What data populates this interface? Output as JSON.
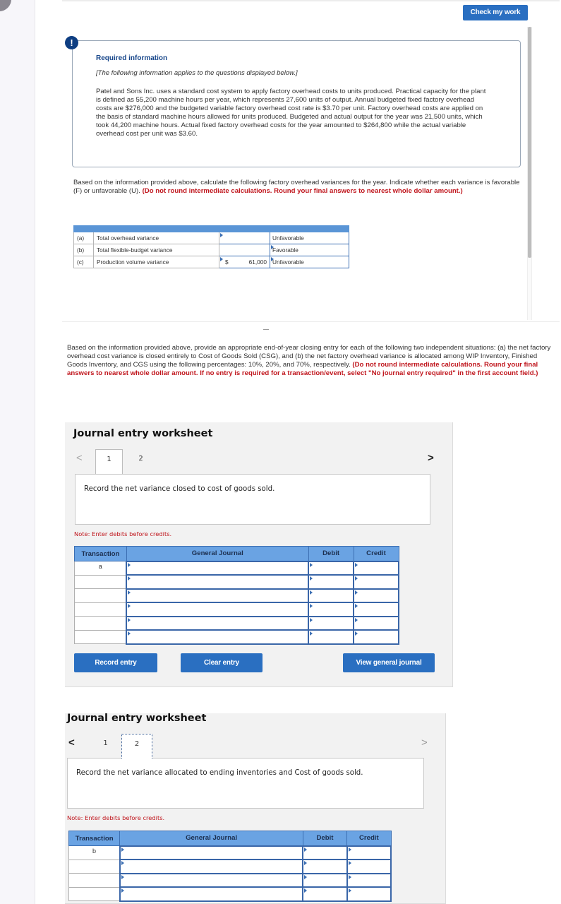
{
  "header": {
    "check_my_work_label": "Check my work"
  },
  "info": {
    "badge": "!",
    "title": "Required information",
    "subtitle": "[The following information applies to the questions displayed below.]",
    "body": "Patel and Sons Inc. uses a standard cost system to apply factory overhead costs to units produced. Practical capacity for the plant is defined as 55,200 machine hours per year, which represents 27,600 units of output. Annual budgeted fixed factory overhead costs are $276,000 and the budgeted variable factory overhead cost rate is $3.70 per unit. Factory overhead costs are applied on the basis of standard machine hours allowed for units produced. Budgeted and actual output for the year was 21,500 units, which took 44,200 machine hours. Actual fixed factory overhead costs for the year amounted to $264,800 while the actual variable overhead cost per unit was $3.60."
  },
  "question1": {
    "text": "Based on the information provided above, calculate the following factory overhead variances for the year. Indicate whether each variance is favorable (F) or unfavorable (U).",
    "instruction": "(Do not round intermediate calculations. Round your final answers to nearest whole dollar amount.)"
  },
  "variances": [
    {
      "letter": "(a)",
      "label": "Total overhead variance",
      "currency": "",
      "amount": "",
      "type": "Unfavorable"
    },
    {
      "letter": "(b)",
      "label": "Total flexible-budget variance",
      "currency": "",
      "amount": "",
      "type": "Favorable"
    },
    {
      "letter": "(c)",
      "label": "Production volume variance",
      "currency": "$",
      "amount": "61,000",
      "type": "Unfavorable"
    }
  ],
  "question2": {
    "text": "Based on the information provided above, provide an appropriate end-of-year closing entry for each of the following two independent situations: (a) the net factory overhead cost variance is closed entirely to Cost of Goods Sold (CSG), and (b) the net factory overhead variance is allocated among WIP Inventory, Finished Goods Inventory, and CGS using the following percentages: 10%, 20%, and 70%, respectively.",
    "instruction": "(Do not round intermediate calculations. Round your final answers to nearest whole dollar amount. If no entry is required for a transaction/event, select \"No journal entry required\" in the first account field.)"
  },
  "worksheet1": {
    "title": "Journal entry worksheet",
    "prev": "<",
    "next": ">",
    "tabs": [
      "1",
      "2"
    ],
    "active_tab": "1",
    "prompt": "Record the net variance closed to cost of goods sold.",
    "note": "Note: Enter debits before credits.",
    "columns": [
      "Transaction",
      "General Journal",
      "Debit",
      "Credit"
    ],
    "rows": [
      {
        "transaction": "a",
        "account": "",
        "debit": "",
        "credit": ""
      },
      {
        "transaction": "",
        "account": "",
        "debit": "",
        "credit": ""
      },
      {
        "transaction": "",
        "account": "",
        "debit": "",
        "credit": ""
      },
      {
        "transaction": "",
        "account": "",
        "debit": "",
        "credit": ""
      },
      {
        "transaction": "",
        "account": "",
        "debit": "",
        "credit": ""
      },
      {
        "transaction": "",
        "account": "",
        "debit": "",
        "credit": ""
      }
    ],
    "buttons": {
      "record": "Record entry",
      "clear": "Clear entry",
      "view": "View general journal"
    }
  },
  "worksheet2": {
    "title": "Journal entry worksheet",
    "prev": "<",
    "next": ">",
    "tabs": [
      "1",
      "2"
    ],
    "active_tab": "2",
    "prompt": "Record the net variance allocated to ending inventories and Cost of goods sold.",
    "note": "Note: Enter debits before credits.",
    "columns": [
      "Transaction",
      "General Journal",
      "Debit",
      "Credit"
    ],
    "rows": [
      {
        "transaction": "b",
        "account": "",
        "debit": "",
        "credit": ""
      },
      {
        "transaction": "",
        "account": "",
        "debit": "",
        "credit": ""
      },
      {
        "transaction": "",
        "account": "",
        "debit": "",
        "credit": ""
      },
      {
        "transaction": "",
        "account": "",
        "debit": "",
        "credit": ""
      }
    ]
  },
  "colors": {
    "accent": "#2a6fc1",
    "header_blue": "#6aa3e3",
    "warning_red": "#c0161d",
    "title_navy": "#17468a"
  }
}
